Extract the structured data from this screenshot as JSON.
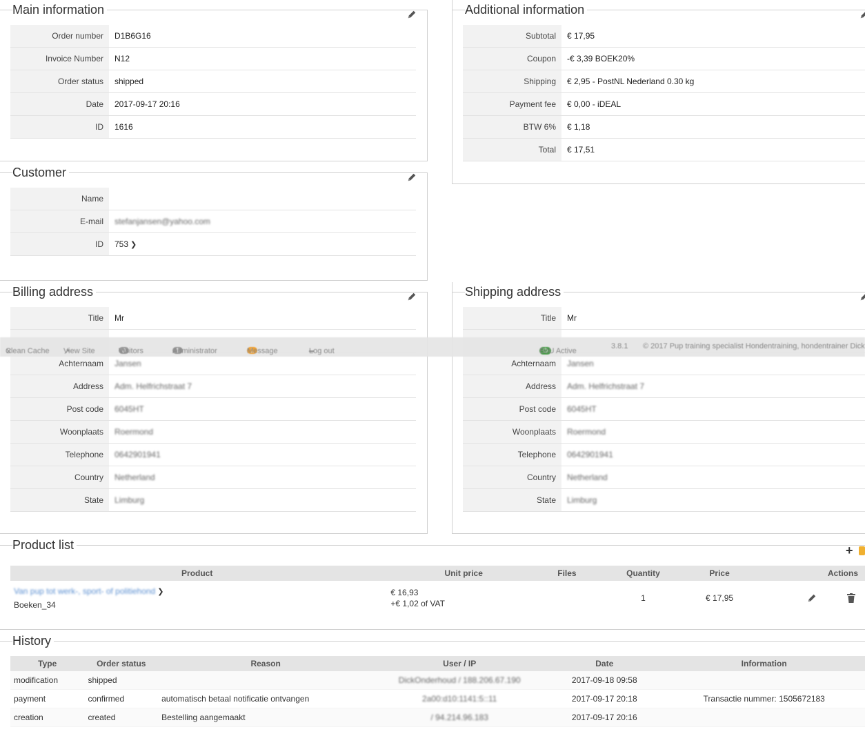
{
  "main_info": {
    "title": "Main information",
    "rows": [
      {
        "label": "Order number",
        "value": "D1B6G16"
      },
      {
        "label": "Invoice Number",
        "value": "N12"
      },
      {
        "label": "Order status",
        "value": "shipped"
      },
      {
        "label": "Date",
        "value": "2017-09-17 20:16"
      },
      {
        "label": "ID",
        "value": "1616"
      }
    ]
  },
  "additional_info": {
    "title": "Additional information",
    "rows": [
      {
        "label": "Subtotal",
        "value": "€ 17,95"
      },
      {
        "label": "Coupon",
        "value": "-€ 3,39 BOEK20%"
      },
      {
        "label": "Shipping",
        "value": "€ 2,95 - PostNL Nederland 0.30 kg"
      },
      {
        "label": "Payment fee",
        "value": "€ 0,00 - iDEAL"
      },
      {
        "label": "BTW 6%",
        "value": "€ 1,18"
      },
      {
        "label": "Total",
        "value": "€ 17,51"
      }
    ]
  },
  "customer": {
    "title": "Customer",
    "rows": [
      {
        "label": "Name",
        "value": ""
      },
      {
        "label": "E-mail",
        "value": "stefanjansen@yahoo.com"
      },
      {
        "label": "ID",
        "value": "753"
      }
    ]
  },
  "billing": {
    "title": "Billing address",
    "rows": [
      {
        "label": "Title",
        "value": "Mr"
      },
      {
        "label": "Achternaam",
        "value": "Jansen"
      },
      {
        "label": "Address",
        "value": "Adm. Helfrichstraat 7"
      },
      {
        "label": "Post code",
        "value": "6045HT"
      },
      {
        "label": "Woonplaats",
        "value": "Roermond"
      },
      {
        "label": "Telephone",
        "value": "0642901941"
      },
      {
        "label": "Country",
        "value": "Netherland"
      },
      {
        "label": "State",
        "value": "Limburg"
      }
    ]
  },
  "shipping": {
    "title": "Shipping address",
    "rows": [
      {
        "label": "Title",
        "value": "Mr"
      },
      {
        "label": "Achternaam",
        "value": "Jansen"
      },
      {
        "label": "Address",
        "value": "Adm. Helfrichstraat 7"
      },
      {
        "label": "Post code",
        "value": "6045HT"
      },
      {
        "label": "Woonplaats",
        "value": "Roermond"
      },
      {
        "label": "Telephone",
        "value": "0642901941"
      },
      {
        "label": "Country",
        "value": "Netherland"
      },
      {
        "label": "State",
        "value": "Limburg"
      }
    ]
  },
  "toolbar": {
    "clean_cache": "Clean Cache",
    "view_site": "View Site",
    "visitors_count": "0",
    "visitors": "Visitors",
    "admin_count": "1",
    "administrator": "Administrator",
    "message_count": "1",
    "message": "Message",
    "logout": "Log out",
    "bou_active": "BoU Active",
    "version": "3.8.1",
    "copyright": "© 2017 Pup training specialist Hondentraining, hondentrainer Dick"
  },
  "products": {
    "title": "Product list",
    "headers": [
      "Product",
      "Unit price",
      "Files",
      "Quantity",
      "Price",
      "Actions"
    ],
    "items": [
      {
        "name": "Van pup tot werk-, sport- of politiehond",
        "sku": "Boeken_34",
        "unit_price": "€ 16,93",
        "vat": "+€ 1,02 of VAT",
        "files": "",
        "quantity": "1",
        "price": "€ 17,95"
      }
    ]
  },
  "history": {
    "title": "History",
    "headers": [
      "Type",
      "Order status",
      "Reason",
      "User / IP",
      "Date",
      "Information"
    ],
    "rows": [
      {
        "type": "modification",
        "status": "shipped",
        "reason": "",
        "user": "DickOnderhoud / 188.206.67.190",
        "date": "2017-09-18 09:58",
        "info": ""
      },
      {
        "type": "payment",
        "status": "confirmed",
        "reason": "automatisch betaal notificatie ontvangen",
        "user": "2a00:d10:1141:5::11",
        "date": "2017-09-17 20:18",
        "info": "Transactie nummer: 1505672183"
      },
      {
        "type": "creation",
        "status": "created",
        "reason": "Bestelling aangemaakt",
        "user": "/ 94.214.96.183",
        "date": "2017-09-17 20:16",
        "info": ""
      }
    ]
  },
  "colors": {
    "link": "#5b8fd1",
    "header_bg": "#e4e4e4",
    "label_bg": "#f2f2f2",
    "message_badge": "#f0a030",
    "bou_badge": "#4a9a4a"
  }
}
